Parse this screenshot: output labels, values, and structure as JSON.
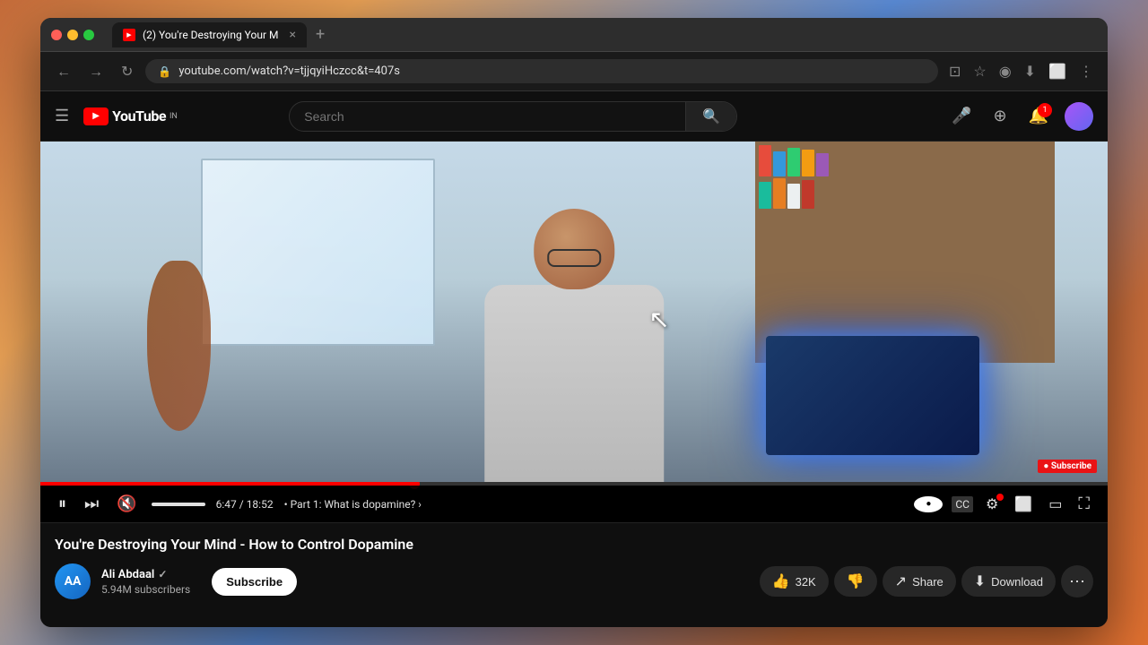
{
  "browser": {
    "tab_title": "(2) You're Destroying Your M",
    "url": "youtube.com/watch?v=tjjqyiHczcc&t=407s",
    "new_tab_label": "+"
  },
  "youtube": {
    "logo_text": "YouTube",
    "logo_country": "IN",
    "search_placeholder": "Search",
    "header_icons": {
      "create": "⊕",
      "notifications": "🔔",
      "notif_count": "1"
    }
  },
  "video": {
    "title": "You're Destroying Your Mind - How to Control Dopamine",
    "time_current": "6:47",
    "time_total": "18:52",
    "chapter": "Part 1: What is dopamine?",
    "progress_percent": 35,
    "watermark": "● Subscribe"
  },
  "channel": {
    "name": "Ali Abdaal",
    "verified": true,
    "subscribers": "5.94M subscribers",
    "subscribe_btn": "Subscribe",
    "avatar_initials": "AA"
  },
  "actions": {
    "like_label": "32K",
    "share_label": "Share",
    "download_label": "Download"
  },
  "controls": {
    "play_icon": "⏸",
    "next_icon": "⏭",
    "volume_icon": "🔇",
    "settings_icon": "⚙",
    "subtitles_icon": "CC",
    "miniplayer_icon": "⬜",
    "theater_icon": "▭",
    "fullscreen_icon": "⛶"
  }
}
